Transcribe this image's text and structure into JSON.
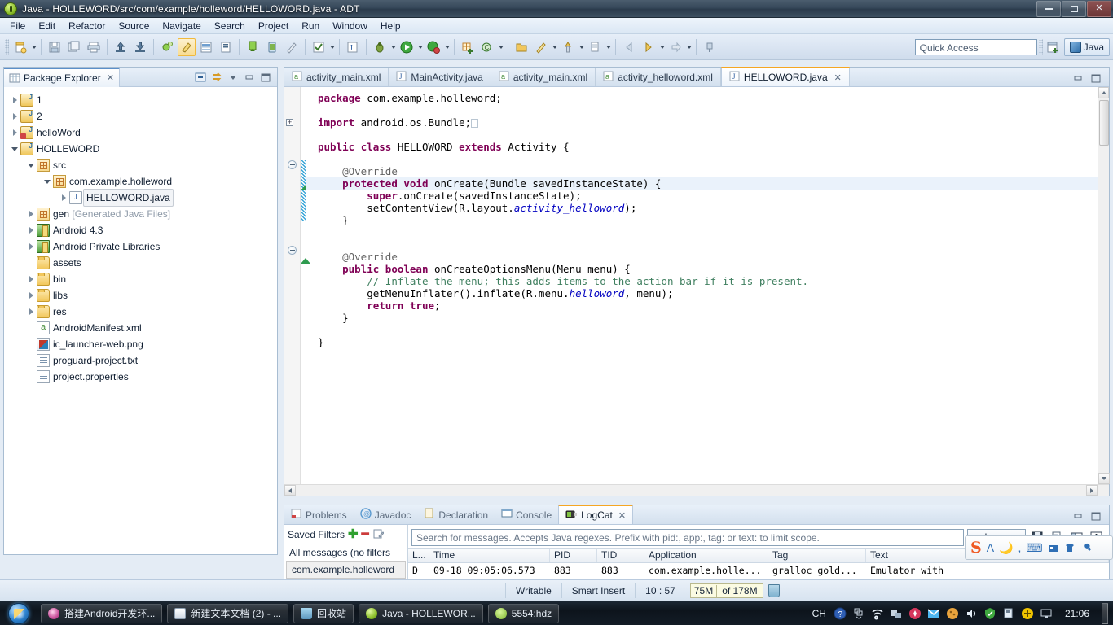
{
  "window": {
    "title": "Java - HOLLEWORD/src/com/example/holleword/HELLOWORD.java - ADT",
    "app_icon": "eclipse-icon",
    "minimize": "—",
    "restore": "❐",
    "close": "✕"
  },
  "menubar": {
    "items": [
      "File",
      "Edit",
      "Refactor",
      "Source",
      "Navigate",
      "Search",
      "Project",
      "Run",
      "Window",
      "Help"
    ]
  },
  "toolbar": {
    "quick_access_placeholder": "Quick Access",
    "perspective_label": "Java",
    "buttons": [
      {
        "name": "new-wizard",
        "glyph": "🗋"
      },
      {
        "name": "save",
        "glyph": "💾"
      },
      {
        "name": "save-all",
        "glyph": "🗍"
      },
      {
        "name": "print",
        "glyph": "🖶"
      },
      {
        "name": "export",
        "glyph": "⬆"
      },
      {
        "name": "import",
        "glyph": "⬇"
      },
      {
        "name": "debug-android",
        "glyph": "🐞"
      },
      {
        "name": "new-android-project",
        "glyph": "🖌"
      },
      {
        "name": "android-virtual-device-manager",
        "glyph": "▤"
      },
      {
        "name": "android-sdk-manager",
        "glyph": "⬓"
      },
      {
        "name": "ddms",
        "glyph": "⤓"
      },
      {
        "name": "android-device",
        "glyph": "▣"
      },
      {
        "name": "toggle-mark-occurrences",
        "glyph": "🖊"
      },
      {
        "name": "toggle-build-automatically",
        "glyph": "☑"
      },
      {
        "name": "open-type",
        "glyph": "🅹"
      },
      {
        "name": "debug",
        "glyph": "🐜"
      },
      {
        "name": "run",
        "glyph": "▶"
      },
      {
        "name": "run-last-tool",
        "glyph": "🔧"
      },
      {
        "name": "new-java-package",
        "glyph": "⊞"
      },
      {
        "name": "new-java-class",
        "glyph": "Ⓒ"
      },
      {
        "name": "open-task",
        "glyph": "🗁"
      },
      {
        "name": "next-annotation",
        "glyph": "✎"
      },
      {
        "name": "previous-annotation",
        "glyph": "⇡"
      },
      {
        "name": "last-edit-location",
        "glyph": "⇠"
      },
      {
        "name": "back",
        "glyph": "⇦"
      },
      {
        "name": "forward",
        "glyph": "⇨"
      },
      {
        "name": "pin-editor",
        "glyph": "📌"
      }
    ]
  },
  "package_explorer": {
    "title": "Package Explorer",
    "actions": [
      "collapse-all-icon",
      "link-with-editor-icon",
      "view-menu-icon",
      "minimize-icon",
      "maximize-icon"
    ],
    "tree": [
      {
        "label": "1",
        "indent": 0,
        "arrow": "collapsed",
        "icon": "ic-proj",
        "dim": ""
      },
      {
        "label": "2",
        "indent": 0,
        "arrow": "collapsed",
        "icon": "ic-proj",
        "dim": ""
      },
      {
        "label": "helloWord",
        "indent": 0,
        "arrow": "collapsed",
        "icon": "ic-proj-err",
        "dim": ""
      },
      {
        "label": "HOLLEWORD",
        "indent": 0,
        "arrow": "expanded",
        "icon": "ic-proj",
        "dim": ""
      },
      {
        "label": "src",
        "indent": 1,
        "arrow": "expanded",
        "icon": "ic-pkg",
        "dim": ""
      },
      {
        "label": "com.example.holleword",
        "indent": 2,
        "arrow": "expanded",
        "icon": "ic-pkgfrag",
        "dim": ""
      },
      {
        "label": "HELLOWORD.java",
        "indent": 3,
        "arrow": "collapsed",
        "icon": "ic-java",
        "dim": "",
        "selected": true
      },
      {
        "label": "gen",
        "indent": 1,
        "arrow": "collapsed",
        "icon": "ic-pkg",
        "dim": "[Generated Java Files]"
      },
      {
        "label": "Android 4.3",
        "indent": 1,
        "arrow": "collapsed",
        "icon": "ic-lib",
        "dim": ""
      },
      {
        "label": "Android Private Libraries",
        "indent": 1,
        "arrow": "collapsed",
        "icon": "ic-lib",
        "dim": ""
      },
      {
        "label": "assets",
        "indent": 1,
        "arrow": "none",
        "icon": "ic-folder",
        "dim": ""
      },
      {
        "label": "bin",
        "indent": 1,
        "arrow": "collapsed",
        "icon": "ic-folder",
        "dim": ""
      },
      {
        "label": "libs",
        "indent": 1,
        "arrow": "collapsed",
        "icon": "ic-folder",
        "dim": ""
      },
      {
        "label": "res",
        "indent": 1,
        "arrow": "collapsed",
        "icon": "ic-folder",
        "dim": ""
      },
      {
        "label": "AndroidManifest.xml",
        "indent": 1,
        "arrow": "none",
        "icon": "ic-xml",
        "dim": ""
      },
      {
        "label": "ic_launcher-web.png",
        "indent": 1,
        "arrow": "none",
        "icon": "ic-png",
        "dim": ""
      },
      {
        "label": "proguard-project.txt",
        "indent": 1,
        "arrow": "none",
        "icon": "ic-txt",
        "dim": ""
      },
      {
        "label": "project.properties",
        "indent": 1,
        "arrow": "none",
        "icon": "ic-txt",
        "dim": ""
      }
    ]
  },
  "editor": {
    "tabs": [
      {
        "label": "activity_main.xml",
        "icon": "xml-file-icon",
        "active": false
      },
      {
        "label": "MainActivity.java",
        "icon": "java-file-icon",
        "active": false
      },
      {
        "label": "activity_main.xml",
        "icon": "xml-file-icon",
        "active": false
      },
      {
        "label": "activity_helloword.xml",
        "icon": "xml-file-icon",
        "active": false
      },
      {
        "label": "HELLOWORD.java",
        "icon": "java-file-icon",
        "active": true
      }
    ],
    "code_lines": [
      {
        "segs": [
          {
            "t": "package",
            "c": "k"
          },
          {
            "t": " com.example.holleword;",
            "c": ""
          }
        ],
        "indent": 0
      },
      {
        "segs": [],
        "indent": 0
      },
      {
        "segs": [
          {
            "t": "import",
            "c": "k"
          },
          {
            "t": " android.os.Bundle;",
            "c": ""
          }
        ],
        "indent": 0,
        "fold_plus": true,
        "box": true
      },
      {
        "segs": [],
        "indent": 0
      },
      {
        "segs": [
          {
            "t": "public",
            "c": "k"
          },
          {
            "t": " ",
            "c": ""
          },
          {
            "t": "class",
            "c": "k"
          },
          {
            "t": " HELLOWORD ",
            "c": ""
          },
          {
            "t": "extends",
            "c": "k"
          },
          {
            "t": " Activity {",
            "c": ""
          }
        ],
        "indent": 0
      },
      {
        "segs": [],
        "indent": 0
      },
      {
        "segs": [
          {
            "t": "@Override",
            "c": "ann"
          }
        ],
        "indent": 1
      },
      {
        "segs": [
          {
            "t": "protected",
            "c": "k"
          },
          {
            "t": " ",
            "c": ""
          },
          {
            "t": "void",
            "c": "k"
          },
          {
            "t": " onCreate(Bundle savedInstanceState) {",
            "c": ""
          }
        ],
        "indent": 1,
        "highlight": true
      },
      {
        "segs": [
          {
            "t": "super",
            "c": "k"
          },
          {
            "t": ".onCreate(savedInstanceState);",
            "c": ""
          }
        ],
        "indent": 2
      },
      {
        "segs": [
          {
            "t": "setContentView(R.layout.",
            "c": ""
          },
          {
            "t": "activity_helloword",
            "c": "fld"
          },
          {
            "t": ");",
            "c": ""
          }
        ],
        "indent": 2
      },
      {
        "segs": [
          {
            "t": "}",
            "c": ""
          }
        ],
        "indent": 1
      },
      {
        "segs": [],
        "indent": 0
      },
      {
        "segs": [],
        "indent": 0
      },
      {
        "segs": [
          {
            "t": "@Override",
            "c": "ann"
          }
        ],
        "indent": 1
      },
      {
        "segs": [
          {
            "t": "public",
            "c": "k"
          },
          {
            "t": " ",
            "c": ""
          },
          {
            "t": "boolean",
            "c": "k"
          },
          {
            "t": " onCreateOptionsMenu(Menu menu) {",
            "c": ""
          }
        ],
        "indent": 1
      },
      {
        "segs": [
          {
            "t": "// Inflate the menu; this adds items to the action bar if it is present.",
            "c": "cm"
          }
        ],
        "indent": 2
      },
      {
        "segs": [
          {
            "t": "getMenuInflater().inflate(R.menu.",
            "c": ""
          },
          {
            "t": "helloword",
            "c": "fld"
          },
          {
            "t": ", menu);",
            "c": ""
          }
        ],
        "indent": 2
      },
      {
        "segs": [
          {
            "t": "return",
            "c": "k"
          },
          {
            "t": " ",
            "c": ""
          },
          {
            "t": "true",
            "c": "k"
          },
          {
            "t": ";",
            "c": ""
          }
        ],
        "indent": 2
      },
      {
        "segs": [
          {
            "t": "}",
            "c": ""
          }
        ],
        "indent": 1
      },
      {
        "segs": [],
        "indent": 0
      },
      {
        "segs": [
          {
            "t": "}",
            "c": ""
          }
        ],
        "indent": 0
      }
    ]
  },
  "bottom_panel": {
    "tabs": [
      {
        "label": "Problems",
        "icon": "problems-icon",
        "active": false
      },
      {
        "label": "Javadoc",
        "icon": "javadoc-icon",
        "active": false
      },
      {
        "label": "Declaration",
        "icon": "declaration-icon",
        "active": false
      },
      {
        "label": "Console",
        "icon": "console-icon",
        "active": false
      },
      {
        "label": "LogCat",
        "icon": "logcat-icon",
        "active": true
      }
    ],
    "logcat": {
      "saved_filters_label": "Saved Filters",
      "add_icon": "plus-icon",
      "remove_icon": "minus-icon",
      "edit_icon": "edit-filter-icon",
      "filters": [
        {
          "label": "All messages (no filters",
          "selected": false
        },
        {
          "label": "com.example.holleword",
          "selected": true
        }
      ],
      "search_placeholder": "Search for messages. Accepts Java regexes. Prefix with pid:, app:, tag: or text: to limit scope.",
      "level": "verbose",
      "toolbar_icons": [
        "save-log-icon",
        "clear-log-icon",
        "display-view-icon",
        "scroll-lock-icon"
      ],
      "columns": [
        "L...",
        "Time",
        "PID",
        "TID",
        "Application",
        "Tag",
        "Text"
      ],
      "rows": [
        {
          "level": "D",
          "time": "09-18 09:05:06.573",
          "pid": "883",
          "tid": "883",
          "application": "com.example.holle...",
          "tag": "gralloc gold...",
          "text": "Emulator with"
        }
      ]
    }
  },
  "statusbar": {
    "writable": "Writable",
    "insert_mode": "Smart Insert",
    "position": "10 : 57",
    "memory_used": "75M",
    "memory_total": "of 178M",
    "gc_icon": "trash-icon"
  },
  "ime": {
    "logo": "S",
    "items": [
      "A",
      "moon-icon",
      "punctuation-icon",
      "keyboard-icon",
      "input-method-icon",
      "skin-icon",
      "tools-icon"
    ]
  },
  "taskbar": {
    "start": "start-orb",
    "items": [
      {
        "label": "搭建Android开发环...",
        "icon_color": "#c94f9a"
      },
      {
        "label": "新建文本文档 (2) - ...",
        "icon_color": "#cfd8e3"
      },
      {
        "label": "回收站",
        "icon_color": "#6fb7dd"
      },
      {
        "label": "Java - HOLLEWOR...",
        "icon_color": "#8cbf2a"
      },
      {
        "label": "5554:hdz",
        "icon_color": "#9ccc3c"
      }
    ],
    "tray": {
      "language": "CH",
      "icons": [
        "help-icon",
        "expand-tray-icon",
        "network-icon",
        "devices-icon",
        "security-icon",
        "mail-icon",
        "cookie-icon",
        "volume-icon",
        "shield-icon",
        "usb-icon",
        "update-icon",
        "display-icon"
      ],
      "clock": "21:06"
    }
  }
}
